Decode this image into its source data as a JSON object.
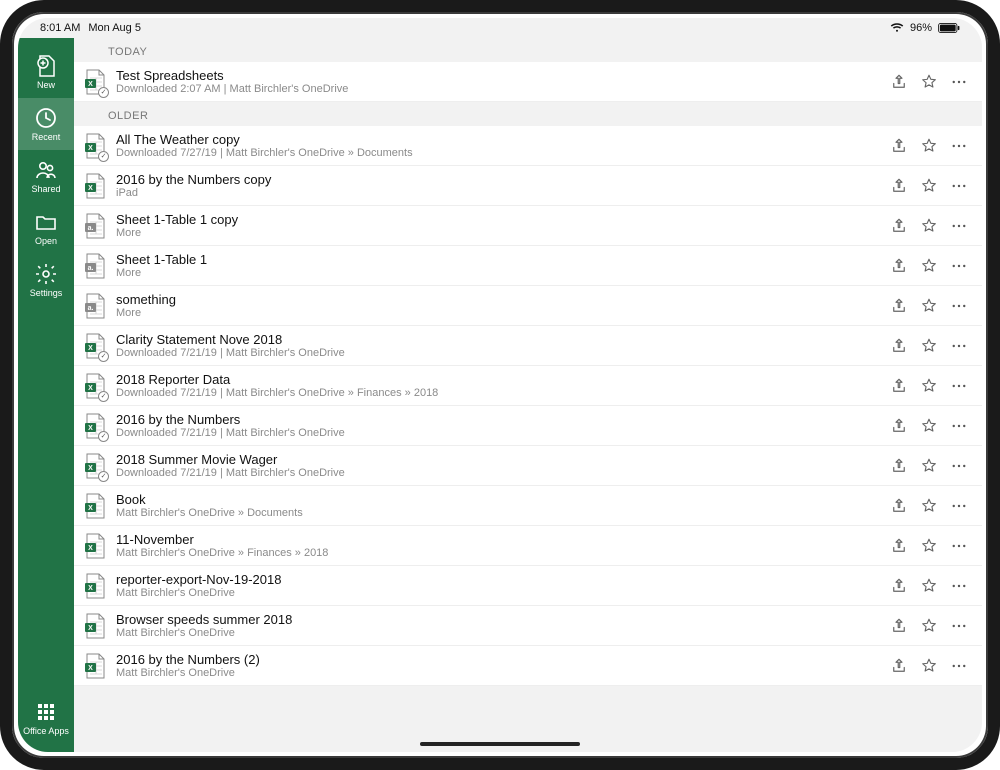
{
  "statusbar": {
    "time": "8:01 AM",
    "date": "Mon Aug 5",
    "battery": "96%"
  },
  "sidebar": {
    "new": "New",
    "recent": "Recent",
    "shared": "Shared",
    "open": "Open",
    "settings": "Settings",
    "officeapps": "Office Apps"
  },
  "sections": {
    "today": "TODAY",
    "older": "OLDER"
  },
  "files": {
    "today": [
      {
        "title": "Test Spreadsheets",
        "sub": "Downloaded 2:07 AM | Matt Birchler's OneDrive",
        "icon": "excel",
        "sync": true
      }
    ],
    "older": [
      {
        "title": "All The Weather copy",
        "sub": "Downloaded 7/27/19 | Matt Birchler's OneDrive » Documents",
        "icon": "excel",
        "sync": true
      },
      {
        "title": "2016 by the Numbers copy",
        "sub": "iPad",
        "icon": "excel",
        "sync": false
      },
      {
        "title": "Sheet 1-Table 1 copy",
        "sub": "More",
        "icon": "gray",
        "sync": false
      },
      {
        "title": "Sheet 1-Table 1",
        "sub": "More",
        "icon": "gray",
        "sync": false
      },
      {
        "title": "something",
        "sub": "More",
        "icon": "gray",
        "sync": false
      },
      {
        "title": "Clarity Statement Nove 2018",
        "sub": "Downloaded 7/21/19 | Matt Birchler's OneDrive",
        "icon": "excel",
        "sync": true
      },
      {
        "title": "2018 Reporter Data",
        "sub": "Downloaded 7/21/19 | Matt Birchler's OneDrive » Finances » 2018",
        "icon": "excel",
        "sync": true
      },
      {
        "title": "2016 by the Numbers",
        "sub": "Downloaded 7/21/19 | Matt Birchler's OneDrive",
        "icon": "excel",
        "sync": true
      },
      {
        "title": "2018 Summer Movie Wager",
        "sub": "Downloaded 7/21/19 | Matt Birchler's OneDrive",
        "icon": "excel",
        "sync": true
      },
      {
        "title": "Book",
        "sub": "Matt Birchler's OneDrive » Documents",
        "icon": "excel",
        "sync": false
      },
      {
        "title": "11-November",
        "sub": "Matt Birchler's OneDrive » Finances » 2018",
        "icon": "excel",
        "sync": false
      },
      {
        "title": "reporter-export-Nov-19-2018",
        "sub": "Matt Birchler's OneDrive",
        "icon": "excel",
        "sync": false
      },
      {
        "title": "Browser speeds summer 2018",
        "sub": "Matt Birchler's OneDrive",
        "icon": "excel",
        "sync": false
      },
      {
        "title": "2016 by the Numbers (2)",
        "sub": "Matt Birchler's OneDrive",
        "icon": "excel",
        "sync": false
      }
    ]
  }
}
